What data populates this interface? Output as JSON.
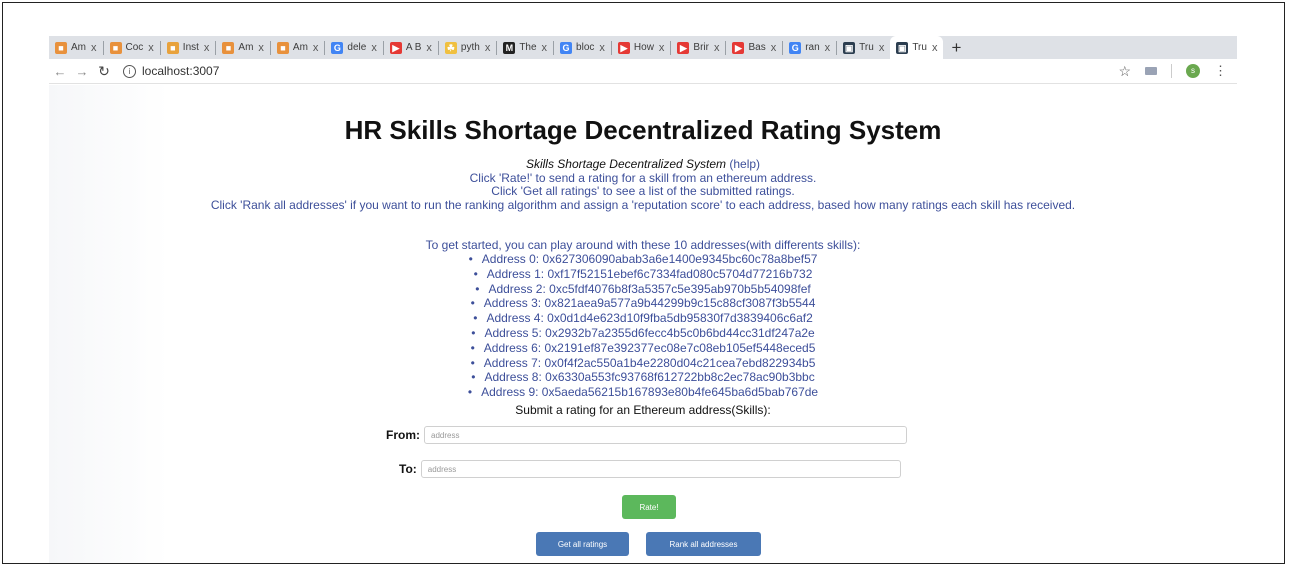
{
  "browser": {
    "tabs": [
      {
        "label": "Am",
        "icon": "cube-icon",
        "color": "#e8913c"
      },
      {
        "label": "Coc",
        "icon": "cube-icon",
        "color": "#e8913c"
      },
      {
        "label": "Inst",
        "icon": "cube-icon",
        "color": "#e8a23c"
      },
      {
        "label": "Am",
        "icon": "cube-icon",
        "color": "#e8913c"
      },
      {
        "label": "Am",
        "icon": "cube-icon",
        "color": "#e8913c"
      },
      {
        "label": "dele",
        "icon": "google-icon",
        "color": "#4285f4"
      },
      {
        "label": "A B",
        "icon": "youtube-icon",
        "color": "#e53935"
      },
      {
        "label": "pyth",
        "icon": "python-icon",
        "color": "#f0c040"
      },
      {
        "label": "The",
        "icon": "medium-icon",
        "color": "#222222"
      },
      {
        "label": "bloc",
        "icon": "google-icon",
        "color": "#4285f4"
      },
      {
        "label": "How",
        "icon": "youtube-icon",
        "color": "#e53935"
      },
      {
        "label": "Brir",
        "icon": "youtube-icon",
        "color": "#e53935"
      },
      {
        "label": "Bas",
        "icon": "youtube-icon",
        "color": "#e53935"
      },
      {
        "label": "ran",
        "icon": "google-icon",
        "color": "#4285f4"
      },
      {
        "label": "Tru",
        "icon": "app-icon",
        "color": "#2c3e50"
      },
      {
        "label": "Tru",
        "icon": "app-icon",
        "color": "#2c3e50",
        "active": true
      }
    ],
    "close_glyph": "x",
    "new_tab_glyph": "+",
    "url": "localhost:3007",
    "profile_initial": "s"
  },
  "page": {
    "title": "HR Skills Shortage Decentralized Rating System",
    "subtitle": "Skills Shortage Decentralized System",
    "help_link": "(help)",
    "instructions": [
      "Click 'Rate!' to send a rating for a skill from an ethereum address.",
      "Click 'Get all ratings' to see a list of the submitted ratings.",
      "Click 'Rank all addresses' if you want to run the ranking algorithm and assign a 'reputation score' to each address, based how many ratings each skill has received."
    ],
    "get_started": "To get started, you can play around with these 10 addresses(with differents skills):",
    "addresses": [
      "Address 0: 0x627306090abab3a6e1400e9345bc60c78a8bef57",
      "Address 1: 0xf17f52151ebef6c7334fad080c5704d77216b732",
      "Address 2: 0xc5fdf4076b8f3a5357c5e395ab970b5b54098fef",
      "Address 3: 0x821aea9a577a9b44299b9c15c88cf3087f3b5544",
      "Address 4: 0x0d1d4e623d10f9fba5db95830f7d3839406c6af2",
      "Address 5: 0x2932b7a2355d6fecc4b5c0b6bd44cc31df247a2e",
      "Address 6: 0x2191ef87e392377ec08e7c08eb105ef5448eced5",
      "Address 7: 0x0f4f2ac550a1b4e2280d04c21cea7ebd822934b5",
      "Address 8: 0x6330a553fc93768f612722bb8c2ec78ac90b3bbc",
      "Address 9: 0x5aeda56215b167893e80b4fe645ba6d5bab767de"
    ],
    "submit_title": "Submit a rating for an Ethereum address(Skills):",
    "from_label": "From:",
    "from_placeholder": "address",
    "to_label": "To:",
    "to_placeholder": "address",
    "rate_button": "Rate!",
    "get_all_button": "Get all ratings",
    "rank_all_button": "Rank all addresses"
  }
}
